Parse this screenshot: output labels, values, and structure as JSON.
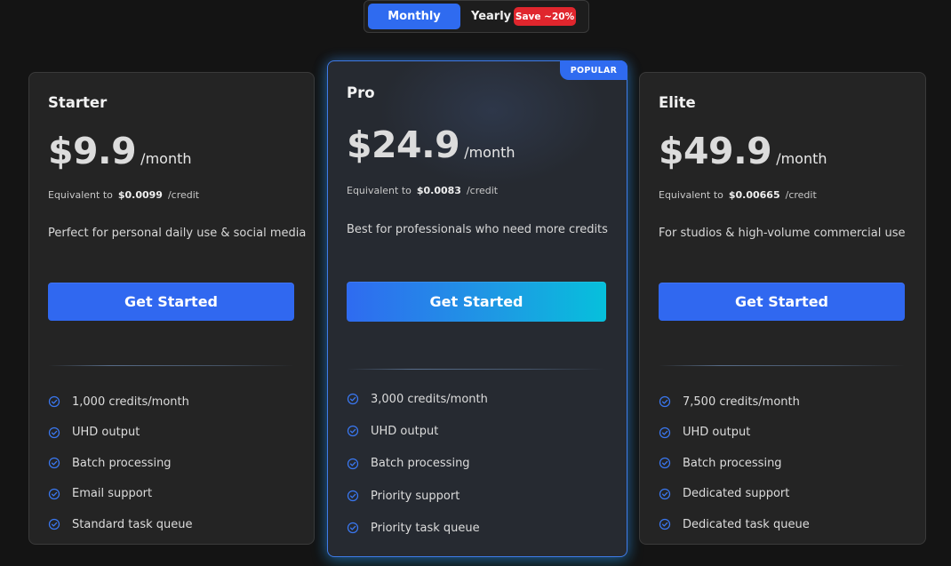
{
  "billing_toggle": {
    "monthly_label": "Monthly",
    "yearly_label": "Yearly",
    "save_badge": "Save ~20%",
    "selected": "Monthly"
  },
  "colors": {
    "accent": "#2f6bf0",
    "popular_border": "#3f7be8",
    "save_badge": "#e0262d",
    "background": "#141414",
    "card": "#242424"
  },
  "plans": [
    {
      "name": "Starter",
      "price": "$9.9",
      "period": "/month",
      "equiv_label": "Equivalent to",
      "equiv_amount": "$0.0099",
      "equiv_unit": "/credit",
      "description": "Perfect for personal daily use & social media",
      "cta": "Get Started",
      "features": [
        "1,000 credits/month",
        "UHD output",
        "Batch processing",
        "Email support",
        "Standard task queue"
      ]
    },
    {
      "name": "Pro",
      "badge": "POPULAR",
      "price": "$24.9",
      "period": "/month",
      "equiv_label": "Equivalent to",
      "equiv_amount": "$0.0083",
      "equiv_unit": "/credit",
      "description": "Best for professionals who need more credits",
      "cta": "Get Started",
      "features": [
        "3,000 credits/month",
        "UHD output",
        "Batch processing",
        "Priority support",
        "Priority task queue"
      ]
    },
    {
      "name": "Elite",
      "price": "$49.9",
      "period": "/month",
      "equiv_label": "Equivalent to",
      "equiv_amount": "$0.00665",
      "equiv_unit": "/credit",
      "description": "For studios & high-volume commercial use",
      "cta": "Get Started",
      "features": [
        "7,500 credits/month",
        "UHD output",
        "Batch processing",
        "Dedicated support",
        "Dedicated task queue"
      ]
    }
  ],
  "icons": {
    "feature_check": "check-circle-icon"
  }
}
